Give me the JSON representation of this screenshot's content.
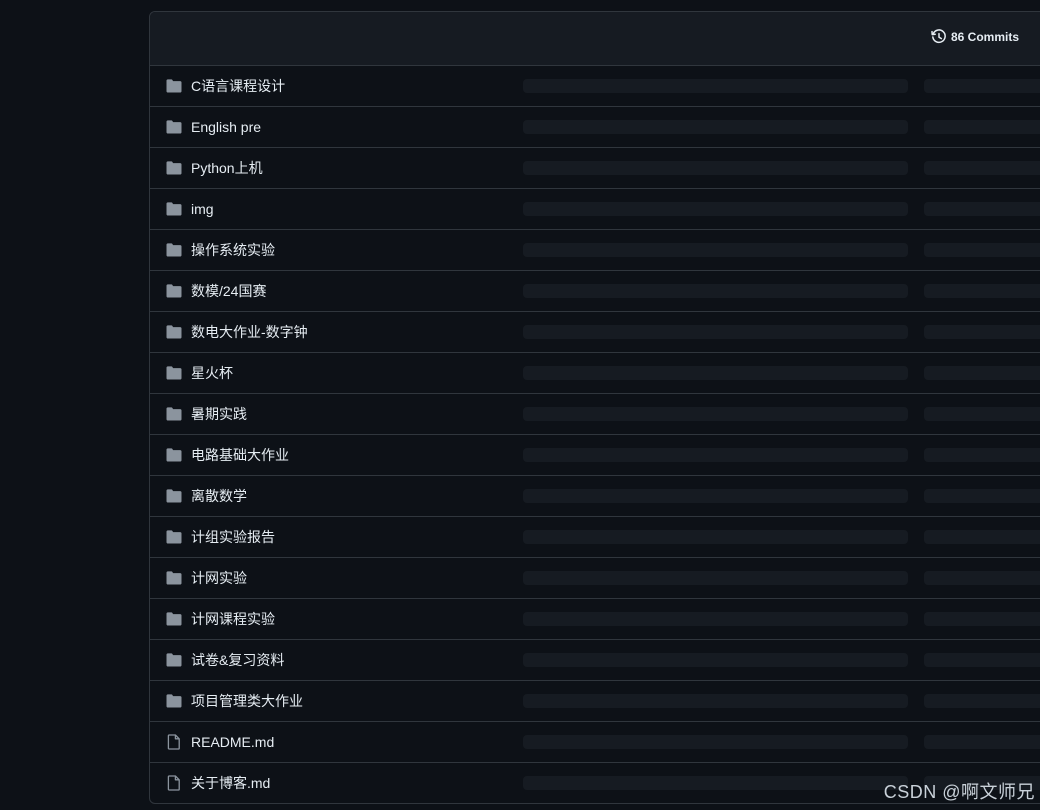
{
  "header": {
    "commits_label": "86 Commits",
    "commits_icon": "history-icon"
  },
  "colors": {
    "page_bg": "#0d1117",
    "header_bg": "#161b22",
    "border": "#30363d",
    "text": "#e6edf3",
    "icon": "#8b949e",
    "skeleton": "#161b22"
  },
  "files": [
    {
      "name": "C语言课程设计",
      "type": "folder"
    },
    {
      "name": "English pre",
      "type": "folder"
    },
    {
      "name": "Python上机",
      "type": "folder"
    },
    {
      "name": "img",
      "type": "folder"
    },
    {
      "name": "操作系统实验",
      "type": "folder"
    },
    {
      "name": "数模/24国赛",
      "type": "folder"
    },
    {
      "name": "数电大作业-数字钟",
      "type": "folder"
    },
    {
      "name": "星火杯",
      "type": "folder"
    },
    {
      "name": "暑期实践",
      "type": "folder"
    },
    {
      "name": "电路基础大作业",
      "type": "folder"
    },
    {
      "name": "离散数学",
      "type": "folder"
    },
    {
      "name": "计组实验报告",
      "type": "folder"
    },
    {
      "name": "计网实验",
      "type": "folder"
    },
    {
      "name": "计网课程实验",
      "type": "folder"
    },
    {
      "name": "试卷&复习资料",
      "type": "folder"
    },
    {
      "name": "项目管理类大作业",
      "type": "folder"
    },
    {
      "name": "README.md",
      "type": "file"
    },
    {
      "name": "关于博客.md",
      "type": "file"
    }
  ],
  "watermark": "CSDN @啊文师兄"
}
